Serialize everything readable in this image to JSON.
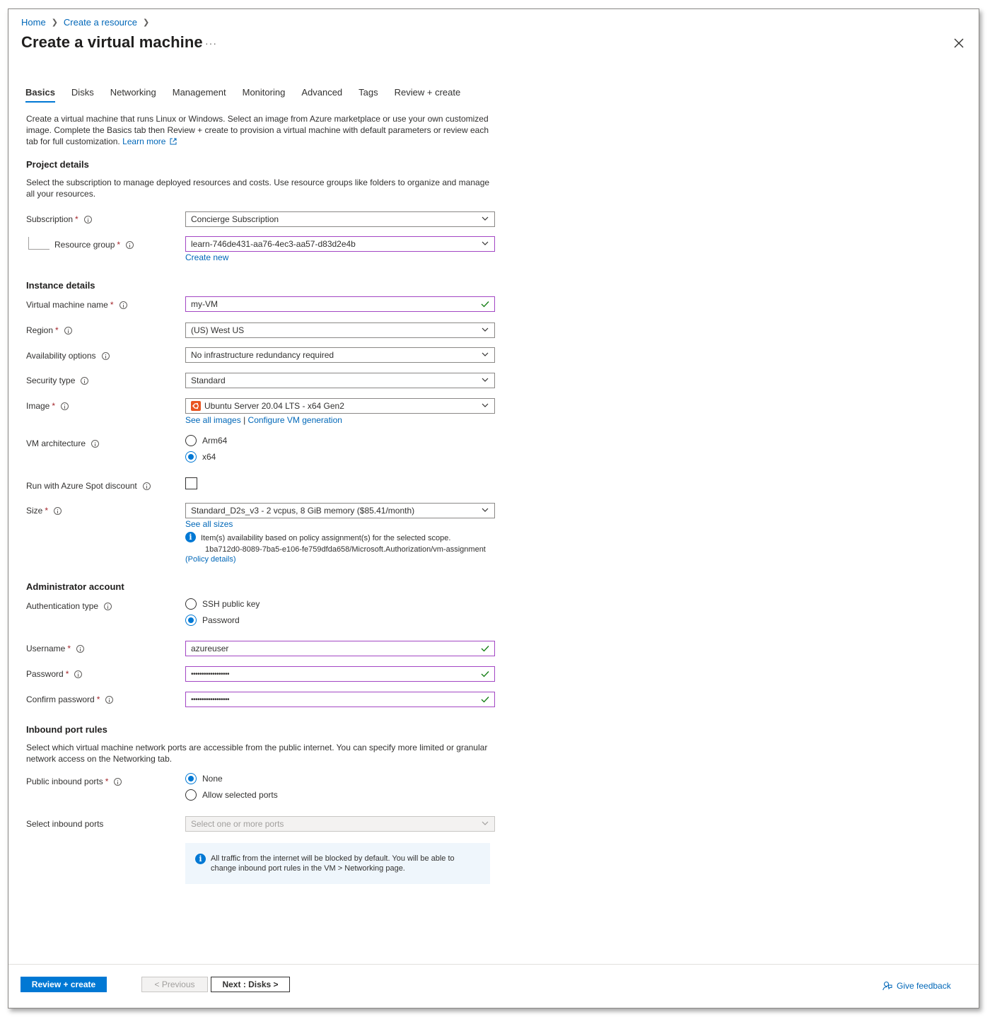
{
  "breadcrumb": {
    "home": "Home",
    "create_resource": "Create a resource"
  },
  "page": {
    "title": "Create a virtual machine",
    "more": "···"
  },
  "tabs": [
    {
      "label": "Basics",
      "active": true
    },
    {
      "label": "Disks"
    },
    {
      "label": "Networking"
    },
    {
      "label": "Management"
    },
    {
      "label": "Monitoring"
    },
    {
      "label": "Advanced"
    },
    {
      "label": "Tags"
    },
    {
      "label": "Review + create"
    }
  ],
  "intro": {
    "text": "Create a virtual machine that runs Linux or Windows. Select an image from Azure marketplace or use your own customized image. Complete the Basics tab then Review + create to provision a virtual machine with default parameters or review each tab for full customization.",
    "learn_more": "Learn more"
  },
  "project": {
    "heading": "Project details",
    "description": "Select the subscription to manage deployed resources and costs. Use resource groups like folders to organize and manage all your resources.",
    "subscription_label": "Subscription",
    "subscription_value": "Concierge Subscription",
    "rg_label": "Resource group",
    "rg_value": "learn-746de431-aa76-4ec3-aa57-d83d2e4b",
    "create_new": "Create new"
  },
  "instance": {
    "heading": "Instance details",
    "vm_name_label": "Virtual machine name",
    "vm_name_value": "my-VM",
    "region_label": "Region",
    "region_value": "(US) West US",
    "availability_label": "Availability options",
    "availability_value": "No infrastructure redundancy required",
    "security_label": "Security type",
    "security_value": "Standard",
    "image_label": "Image",
    "image_value": "Ubuntu Server 20.04 LTS - x64 Gen2",
    "see_all_images": "See all images",
    "pipe": "|",
    "configure_vm": "Configure VM generation",
    "arch_label": "VM architecture",
    "arch_arm": "Arm64",
    "arch_x64": "x64",
    "spot_label": "Run with Azure Spot discount",
    "size_label": "Size",
    "size_value": "Standard_D2s_v3 - 2 vcpus, 8 GiB memory ($85.41/month)",
    "see_all_sizes": "See all sizes",
    "policy_line1": "Item(s) availability based on policy assignment(s) for the selected scope.",
    "policy_line2": "1ba712d0-8089-7ba5-e106-fe759dfda658/Microsoft.Authorization/vm-assignment",
    "policy_details": "(Policy details)"
  },
  "admin": {
    "heading": "Administrator account",
    "auth_label": "Authentication type",
    "auth_ssh": "SSH public key",
    "auth_password": "Password",
    "username_label": "Username",
    "username_value": "azureuser",
    "password_label": "Password",
    "password_value": "••••••••••••••••••",
    "confirm_label": "Confirm password",
    "confirm_value": "••••••••••••••••••"
  },
  "inbound": {
    "heading": "Inbound port rules",
    "description": "Select which virtual machine network ports are accessible from the public internet. You can specify more limited or granular network access on the Networking tab.",
    "public_label": "Public inbound ports",
    "opt_none": "None",
    "opt_allow": "Allow selected ports",
    "select_label": "Select inbound ports",
    "select_placeholder": "Select one or more ports",
    "notice": "All traffic from the internet will be blocked by default. You will be able to change inbound port rules in the VM > Networking page."
  },
  "footer": {
    "review_create": "Review + create",
    "previous": "< Previous",
    "next": "Next : Disks >",
    "feedback": "Give feedback"
  },
  "colors": {
    "accent": "#0078d4",
    "link": "#0067b8",
    "required": "#a4262c",
    "valid_border": "#a347c4",
    "valid_check": "#107c10"
  },
  "required_mark": "*",
  "info_glyph": "i"
}
